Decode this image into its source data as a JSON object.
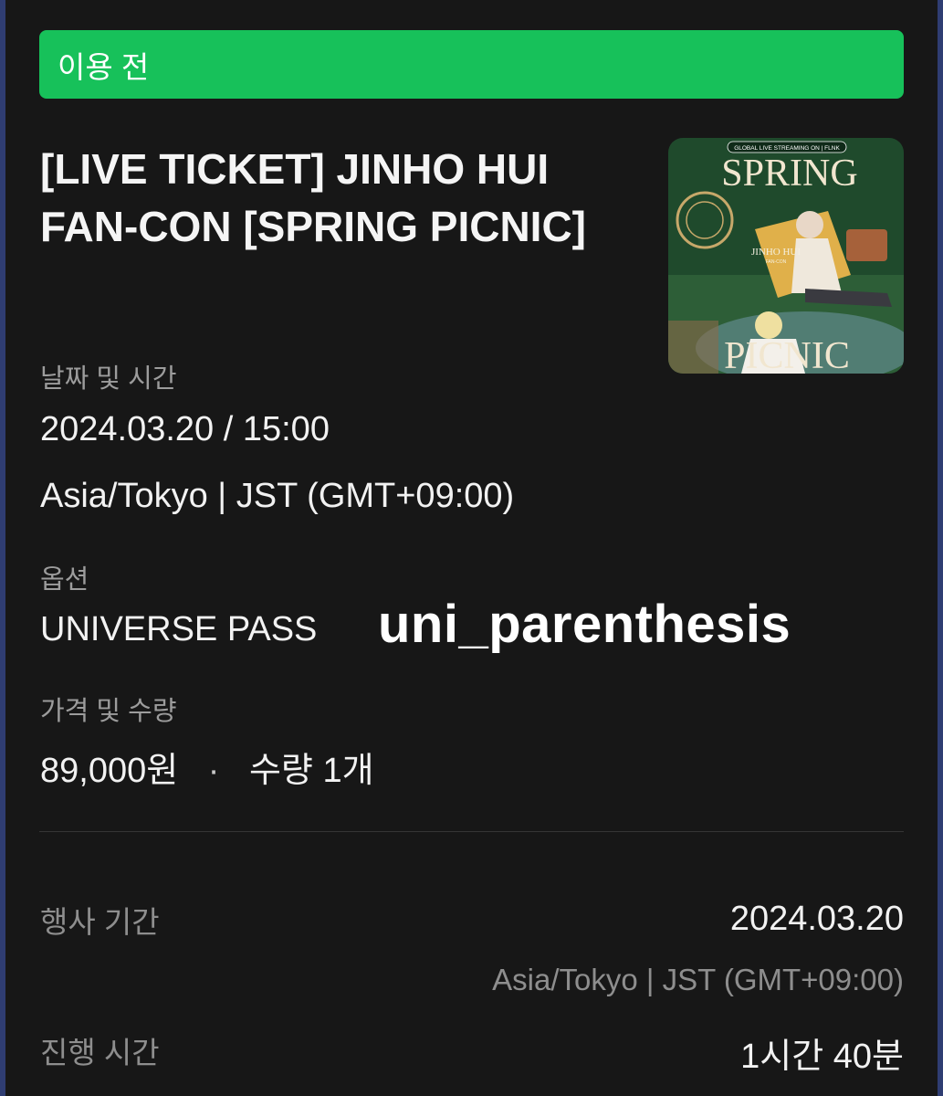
{
  "status": {
    "label": "이용 전",
    "color": "#17c15a"
  },
  "ticket": {
    "title": "[LIVE TICKET] JINHO HUI FAN-CON [SPRING PICNIC]",
    "poster": {
      "top_text": "GLOBAL LIVE STREAMING ON | FLNK",
      "line1": "SPRING",
      "line2": "PICNIC",
      "artist": "JINHO HUI",
      "subtitle": "FAN-CON"
    },
    "datetime_label": "날짜 및 시간",
    "datetime_value": "2024.03.20 / 15:00",
    "timezone": "Asia/Tokyo | JST (GMT+09:00)",
    "option_label": "옵션",
    "option_value": "UNIVERSE PASS",
    "watermark": "uni_parenthesis",
    "price_label": "가격 및 수량",
    "price_value": "89,000원",
    "price_separator": "·",
    "quantity_value": "수량 1개"
  },
  "details": {
    "event_period_label": "행사 기간",
    "event_period_value": "2024.03.20",
    "event_period_timezone": "Asia/Tokyo | JST (GMT+09:00)",
    "duration_label": "진행 시간",
    "duration_value": "1시간 40분"
  }
}
